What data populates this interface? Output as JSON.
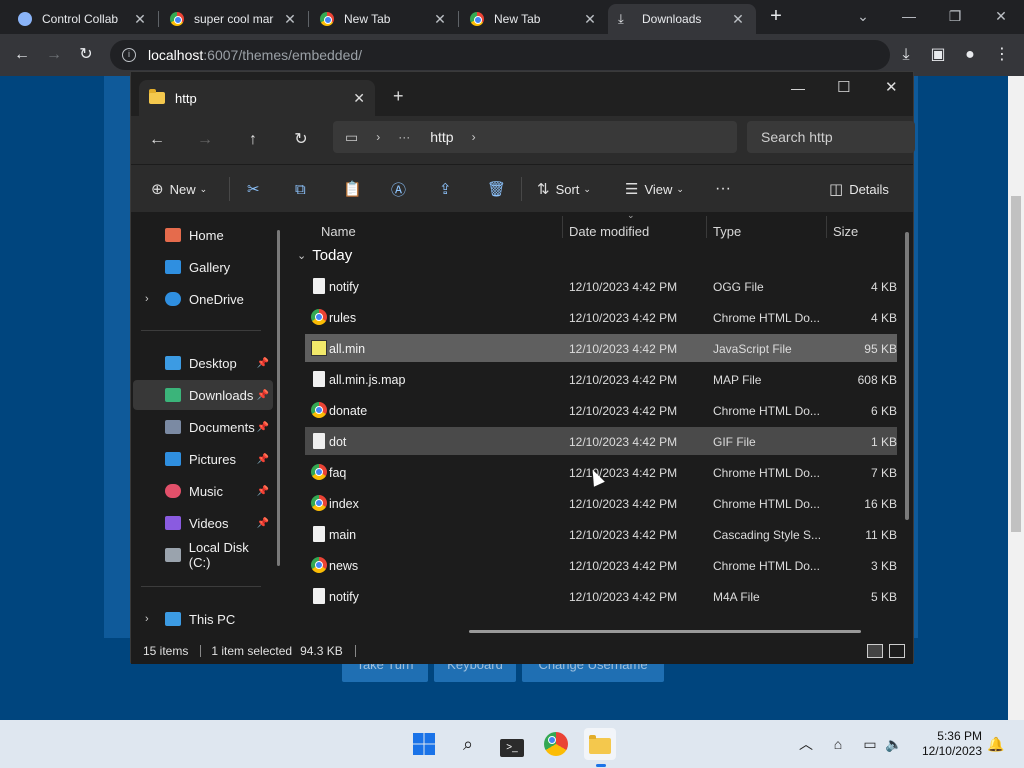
{
  "browser": {
    "tabs": [
      {
        "title": "Control Collab",
        "favicon_color": "#8ab4f8"
      },
      {
        "title": "super cool mar",
        "favicon_color": "#e8eaed"
      },
      {
        "title": "New Tab",
        "favicon_color": "#e8eaed"
      },
      {
        "title": "New Tab",
        "favicon_color": "#e8eaed"
      },
      {
        "title": "Downloads",
        "favicon_color": "#e8eaed"
      }
    ],
    "new_tab_glyph": "+",
    "url_host": "localhost",
    "url_port": ":6007",
    "url_path": "/themes/embedded/"
  },
  "page": {
    "buttons": [
      "Take Turn",
      "Keyboard",
      "Change Username"
    ]
  },
  "explorer": {
    "tab_title": "http",
    "breadcrumb": [
      "http"
    ],
    "search_placeholder": "Search http",
    "commands": {
      "new": "New",
      "sort": "Sort",
      "view": "View",
      "details": "Details"
    },
    "sidebar": {
      "items": [
        {
          "label": "Home",
          "icon": "home-icon",
          "color": "#e56b4c"
        },
        {
          "label": "Gallery",
          "icon": "gallery-icon",
          "color": "#2f8fe0"
        },
        {
          "label": "OneDrive",
          "icon": "cloud-icon",
          "color": "#2f8fe0"
        },
        {
          "label": "Desktop",
          "icon": "desktop-icon",
          "color": "#3c9be3"
        },
        {
          "label": "Downloads",
          "icon": "download-icon",
          "color": "#3bb47a"
        },
        {
          "label": "Documents",
          "icon": "documents-icon",
          "color": "#7b8aa3"
        },
        {
          "label": "Pictures",
          "icon": "pictures-icon",
          "color": "#2f8fe0"
        },
        {
          "label": "Music",
          "icon": "music-icon",
          "color": "#e2506a"
        },
        {
          "label": "Videos",
          "icon": "videos-icon",
          "color": "#8a5be0"
        },
        {
          "label": "Local Disk (C:)",
          "icon": "disk-icon",
          "color": "#9aa3ad"
        },
        {
          "label": "This PC",
          "icon": "pc-icon",
          "color": "#3c9be3"
        }
      ]
    },
    "columns": [
      "Name",
      "Date modified",
      "Type",
      "Size"
    ],
    "group_label": "Today",
    "files": [
      {
        "name": "notify",
        "date": "12/10/2023 4:42 PM",
        "type": "OGG File",
        "size": "4 KB",
        "icon": "doc"
      },
      {
        "name": "rules",
        "date": "12/10/2023 4:42 PM",
        "type": "Chrome HTML Do...",
        "size": "4 KB",
        "icon": "chrome"
      },
      {
        "name": "all.min",
        "date": "12/10/2023 4:42 PM",
        "type": "JavaScript File",
        "size": "95 KB",
        "icon": "js"
      },
      {
        "name": "all.min.js.map",
        "date": "12/10/2023 4:42 PM",
        "type": "MAP File",
        "size": "608 KB",
        "icon": "doc"
      },
      {
        "name": "donate",
        "date": "12/10/2023 4:42 PM",
        "type": "Chrome HTML Do...",
        "size": "6 KB",
        "icon": "chrome"
      },
      {
        "name": "dot",
        "date": "12/10/2023 4:42 PM",
        "type": "GIF File",
        "size": "1 KB",
        "icon": "doc"
      },
      {
        "name": "faq",
        "date": "12/10/2023 4:42 PM",
        "type": "Chrome HTML Do...",
        "size": "7 KB",
        "icon": "chrome"
      },
      {
        "name": "index",
        "date": "12/10/2023 4:42 PM",
        "type": "Chrome HTML Do...",
        "size": "16 KB",
        "icon": "chrome"
      },
      {
        "name": "main",
        "date": "12/10/2023 4:42 PM",
        "type": "Cascading Style S...",
        "size": "11 KB",
        "icon": "doc"
      },
      {
        "name": "news",
        "date": "12/10/2023 4:42 PM",
        "type": "Chrome HTML Do...",
        "size": "3 KB",
        "icon": "chrome"
      },
      {
        "name": "notify",
        "date": "12/10/2023 4:42 PM",
        "type": "M4A File",
        "size": "5 KB",
        "icon": "doc"
      }
    ],
    "status": {
      "items": "15 items",
      "selected": "1 item selected",
      "size": "94.3 KB"
    }
  },
  "taskbar": {
    "time": "5:36 PM",
    "date": "12/10/2023"
  }
}
